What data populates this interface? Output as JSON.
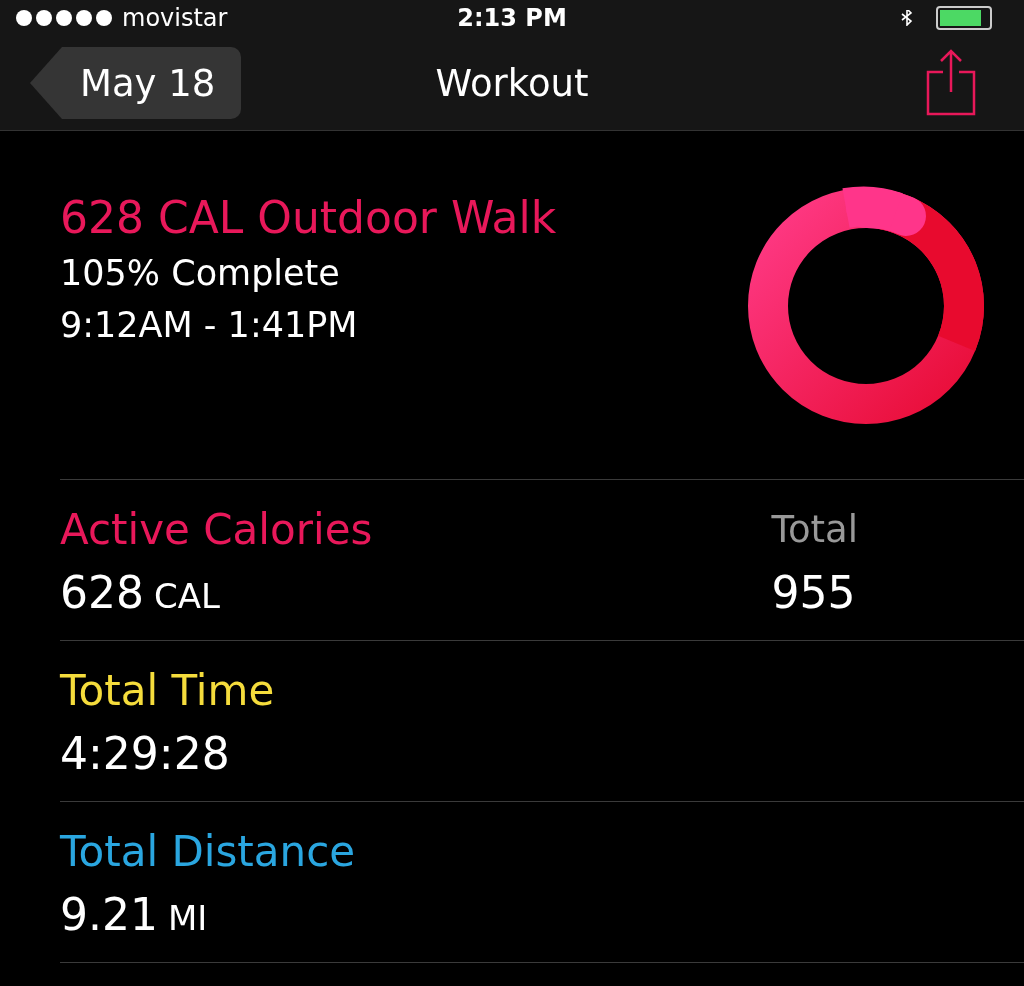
{
  "status_bar": {
    "carrier": "movistar",
    "time": "2:13 PM"
  },
  "nav": {
    "back": "May 18",
    "title": "Workout"
  },
  "summary": {
    "headline": "628 CAL Outdoor Walk",
    "completion": "105% Complete",
    "time_range": "9:12AM - 1:41PM"
  },
  "metrics": [
    {
      "label": "Active Calories",
      "color": "#e8185a",
      "value": "628",
      "unit": "CAL",
      "secondary": {
        "label": "Total",
        "value": "955"
      }
    },
    {
      "label": "Total Time",
      "color": "#f5dc3c",
      "value": "4:29:28"
    },
    {
      "label": "Total Distance",
      "color": "#2aa6e0",
      "value": "9.21",
      "unit": "MI"
    }
  ]
}
